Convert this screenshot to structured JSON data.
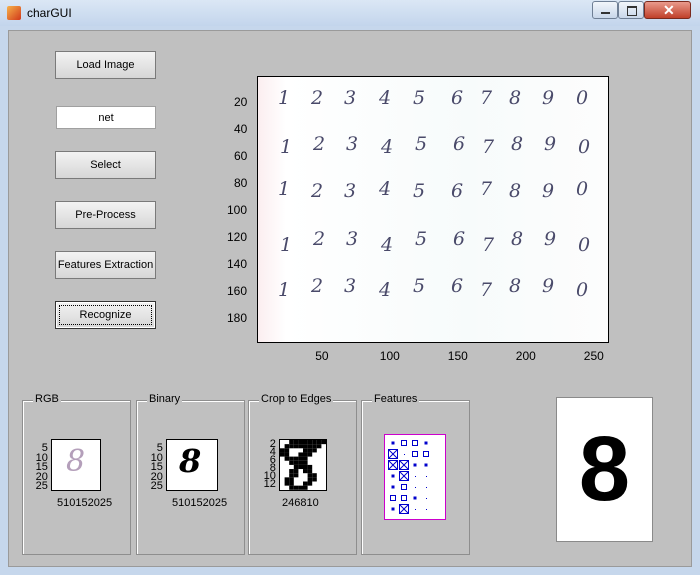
{
  "window": {
    "title": "charGUI"
  },
  "buttons": {
    "load_image": "Load Image",
    "select": "Select",
    "preprocess": "Pre-Process",
    "features": "Features Extraction",
    "recognize": "Recognize"
  },
  "net_field": {
    "value": "net"
  },
  "main_axes": {
    "y_ticks": [
      "20",
      "40",
      "60",
      "80",
      "100",
      "120",
      "140",
      "160",
      "180"
    ],
    "x_ticks": [
      "50",
      "100",
      "150",
      "200",
      "250"
    ],
    "digit_rows": [
      [
        "1",
        "2",
        "3",
        "4",
        "5",
        "6",
        "7",
        "8",
        "9",
        "0"
      ],
      [
        "1",
        "2",
        "3",
        "4",
        "5",
        "6",
        "7",
        "8",
        "9",
        "0"
      ],
      [
        "1",
        "2",
        "3",
        "4",
        "5",
        "6",
        "7",
        "8",
        "9",
        "0"
      ],
      [
        "1",
        "2",
        "3",
        "4",
        "5",
        "6",
        "7",
        "8",
        "9",
        "0"
      ],
      [
        "1",
        "2",
        "3",
        "4",
        "5",
        "6",
        "7",
        "8",
        "9",
        "0"
      ]
    ]
  },
  "panels": {
    "rgb": {
      "title": "RGB",
      "y_ticks": [
        "5",
        "10",
        "15",
        "20",
        "25"
      ],
      "x_ticks": "510152025",
      "glyph": "8"
    },
    "binary": {
      "title": "Binary",
      "y_ticks": [
        "5",
        "10",
        "15",
        "20",
        "25"
      ],
      "x_ticks": "510152025",
      "glyph": "8"
    },
    "crop": {
      "title": "Crop to Edges",
      "y_ticks": [
        "2",
        "4",
        "6",
        "8",
        "10",
        "12"
      ],
      "x_ticks": "246810"
    },
    "features": {
      "title": "Features"
    }
  },
  "result": {
    "digit": "8"
  },
  "colors": {
    "client_bg": "#c0c0c0",
    "feature_border": "#cc00cc",
    "feature_marks": "#0000cc"
  }
}
